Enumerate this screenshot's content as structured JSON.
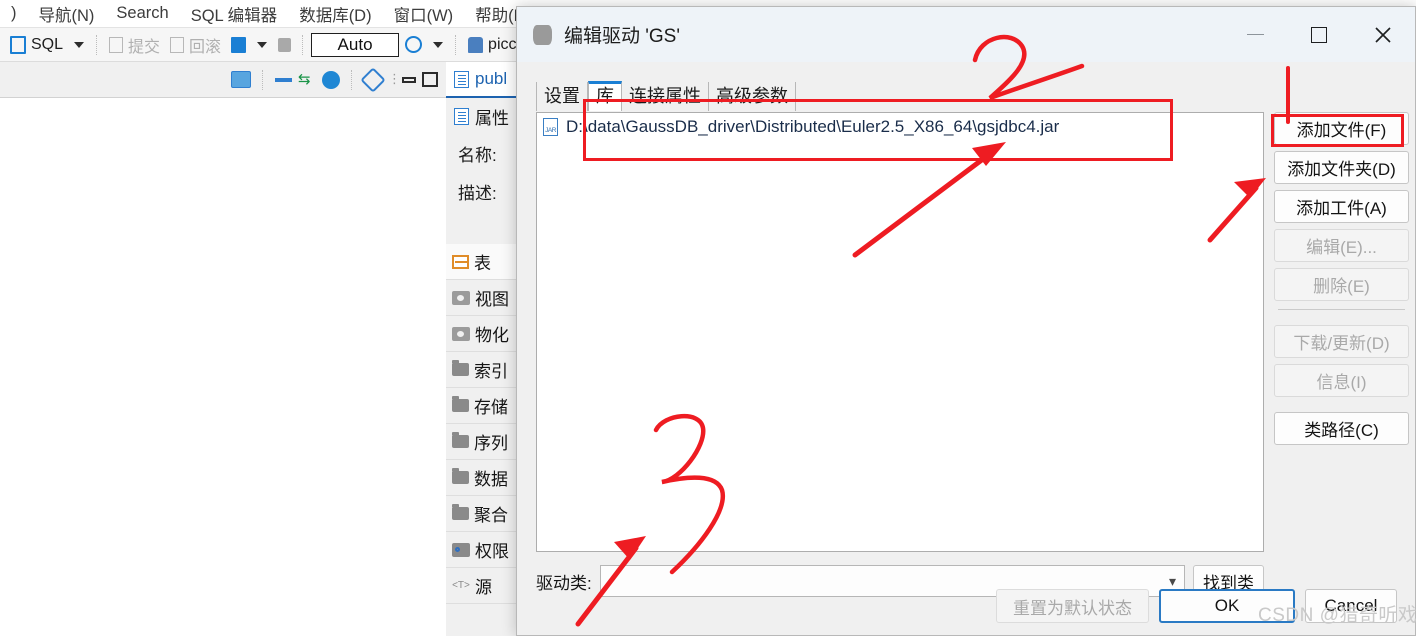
{
  "app": {
    "menubar": {
      "items": [
        {
          "label": ")"
        },
        {
          "label": "导航(N)"
        },
        {
          "label": "Search"
        },
        {
          "label": "SQL 编辑器"
        },
        {
          "label": "数据库(D)"
        },
        {
          "label": "窗口(W)"
        },
        {
          "label": "帮助(H)"
        }
      ]
    },
    "toolbar": {
      "sql_label": "SQL",
      "commit_label": "提交",
      "rollback_label": "回滚",
      "auto_value": "Auto",
      "connection_label": "picc"
    },
    "left_panel": {
      "tab_label": "publ",
      "properties_label": "属性",
      "name_label": "名称:",
      "description_label": "描述:",
      "items": [
        {
          "label": "表",
          "icon": "table-icon"
        },
        {
          "label": "视图",
          "icon": "view-icon"
        },
        {
          "label": "物化",
          "icon": "materialized-view-icon"
        },
        {
          "label": "索引",
          "icon": "folder-icon"
        },
        {
          "label": "存储",
          "icon": "folder-icon"
        },
        {
          "label": "序列",
          "icon": "folder-icon"
        },
        {
          "label": "数据",
          "icon": "folder-icon"
        },
        {
          "label": "聚合",
          "icon": "folder-icon"
        },
        {
          "label": "权限",
          "icon": "key-icon"
        },
        {
          "label": "源",
          "icon": "source-icon"
        }
      ]
    }
  },
  "dialog": {
    "title": "编辑驱动 'GS'",
    "window_buttons": {
      "minimize": "—",
      "maximize": "□",
      "close": "×"
    },
    "tabs": [
      {
        "label": "设置",
        "active": false
      },
      {
        "label": "库",
        "active": true
      },
      {
        "label": "连接属性",
        "active": false
      },
      {
        "label": "高级参数",
        "active": false
      }
    ],
    "library_list": [
      {
        "path": "D:\\data\\GaussDB_driver\\Distributed\\Euler2.5_X86_64\\gsjdbc4.jar",
        "icon": "jar-file-icon"
      }
    ],
    "side_buttons": [
      {
        "label": "添加文件(F)",
        "disabled": false,
        "separator_after": false
      },
      {
        "label": "添加文件夹(D)",
        "disabled": false,
        "separator_after": false
      },
      {
        "label": "添加工件(A)",
        "disabled": false,
        "separator_after": false
      },
      {
        "label": "编辑(E)...",
        "disabled": true,
        "separator_after": false
      },
      {
        "label": "删除(E)",
        "disabled": true,
        "separator_after": true
      },
      {
        "label": "下载/更新(D)",
        "disabled": true,
        "separator_after": false
      },
      {
        "label": "信息(I)",
        "disabled": true,
        "separator_after": true
      },
      {
        "label": "类路径(C)",
        "disabled": false,
        "separator_after": false
      }
    ],
    "driver_class": {
      "label": "驱动类:",
      "value": "",
      "placeholder": "",
      "find_button": "找到类"
    },
    "footer_buttons": [
      {
        "label": "重置为默认状态",
        "disabled": true,
        "primary": false
      },
      {
        "label": "OK",
        "disabled": false,
        "primary": true
      },
      {
        "label": "Cancel",
        "disabled": false,
        "primary": false
      }
    ]
  },
  "annotations": {
    "color": "#ee1c22",
    "marks": [
      {
        "name": "step-2",
        "text": "2"
      },
      {
        "name": "step-3",
        "text": "3"
      }
    ]
  },
  "watermark": {
    "text": "CSDN @猎奇听戏"
  }
}
